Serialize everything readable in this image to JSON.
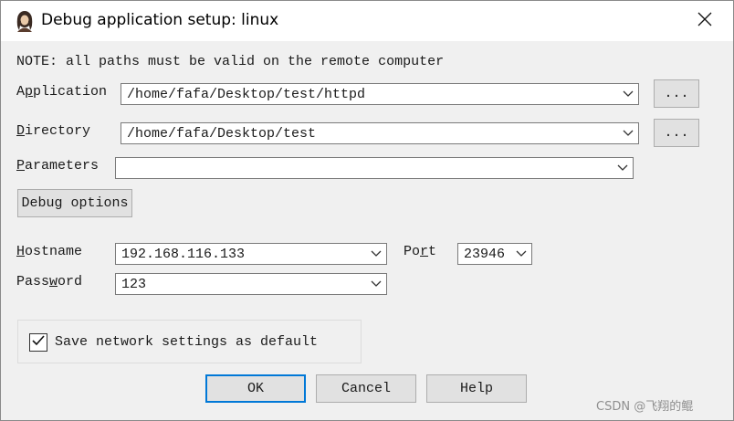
{
  "window": {
    "title": "Debug application setup: linux",
    "icon": "portrait-app-icon",
    "close_icon": "close-icon"
  },
  "note": "NOTE: all paths must be valid on the remote computer",
  "fields": {
    "application": {
      "label_pre": "A",
      "label_u": "p",
      "label_post": "plication",
      "value": "/home/fafa/Desktop/test/httpd",
      "browse_label": "..."
    },
    "directory": {
      "label_pre": "",
      "label_u": "D",
      "label_post": "irectory",
      "value": "/home/fafa/Desktop/test",
      "browse_label": "..."
    },
    "parameters": {
      "label_pre": "",
      "label_u": "P",
      "label_post": "arameters",
      "value": ""
    }
  },
  "debug_options_label": "Debug options",
  "network": {
    "hostname": {
      "label_pre": "",
      "label_u": "H",
      "label_post": "ostname",
      "value": "192.168.116.133"
    },
    "port": {
      "label_pre": "Po",
      "label_u": "r",
      "label_post": "t",
      "value": "23946"
    },
    "password": {
      "label_pre": "Pass",
      "label_u": "w",
      "label_post": "ord",
      "value": "123"
    }
  },
  "save_default": {
    "label": "Save network settings as default",
    "checked": true
  },
  "buttons": {
    "ok": "OK",
    "cancel": "Cancel",
    "help": "Help"
  },
  "watermark": "CSDN @飞翔的鲲",
  "colors": {
    "dialog_bg": "#f0f0f0",
    "titlebar_bg": "#ffffff",
    "default_button_border": "#0078d7",
    "button_bg": "#e1e1e1"
  }
}
